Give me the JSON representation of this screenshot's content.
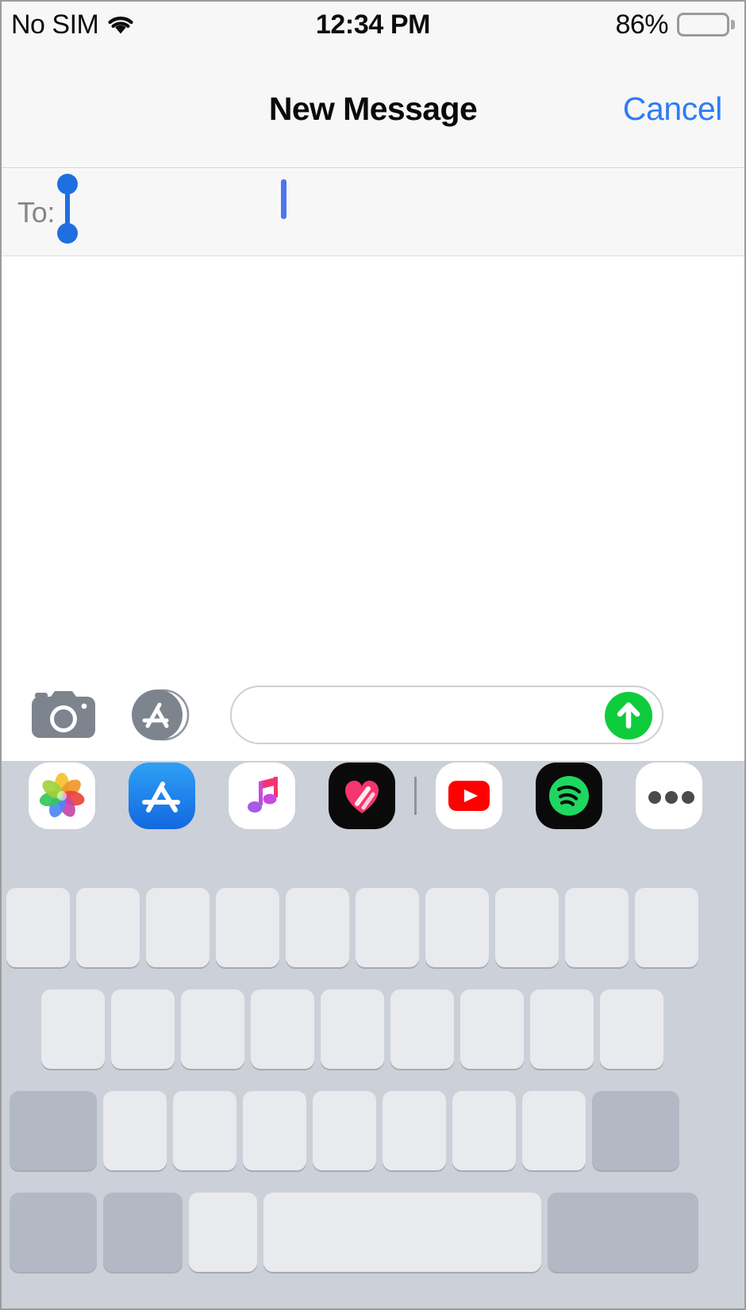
{
  "status_bar": {
    "carrier": "No SIM",
    "wifi_icon": "wifi-icon",
    "time": "12:34 PM",
    "battery_percent": "86%",
    "battery_level": 86,
    "battery_icon": "battery-icon"
  },
  "nav_bar": {
    "title": "New Message",
    "cancel_label": "Cancel"
  },
  "to_field": {
    "label": "To:",
    "value": "",
    "placeholder": "",
    "add_contact_icon": "plus-circle-icon",
    "selection_handle_icon": "text-selection-handle-icon",
    "caret_icon": "text-caret-icon"
  },
  "toolbar": {
    "camera_icon": "camera-icon",
    "appstore_icon": "app-store-icon",
    "message_input_placeholder": "",
    "message_input_value": "",
    "send_icon": "send-arrow-up-icon"
  },
  "app_drawer": {
    "apps": [
      {
        "name": "photos-app",
        "icon": "photos-icon",
        "bg": "#ffffff"
      },
      {
        "name": "app-store-app",
        "icon": "app-store-icon",
        "bg": "#1e8fe8"
      },
      {
        "name": "music-app",
        "icon": "music-note-icon",
        "bg": "#ffffff"
      },
      {
        "name": "digital-touch-app",
        "icon": "heart-icon",
        "bg": "#0a0a0a"
      },
      {
        "name": "youtube-app",
        "icon": "youtube-play-icon",
        "bg": "#ffffff"
      },
      {
        "name": "spotify-app",
        "icon": "spotify-icon",
        "bg": "#0a0a0a"
      },
      {
        "name": "more-apps",
        "icon": "ellipsis-icon",
        "bg": "#ffffff"
      }
    ]
  },
  "keyboard": {
    "visible": true,
    "blank_keys": true,
    "row1_count": 10,
    "row2_count": 9,
    "row3_count": 9,
    "row4_count": 5
  },
  "colors": {
    "accent_blue": "#2d7cf6",
    "send_green": "#0fcc3c",
    "keyboard_bg": "#ccd0d8",
    "key_bg": "#e8eaee",
    "key_dark_bg": "#b3b9c4",
    "chrome_bg": "#f7f7f7"
  }
}
